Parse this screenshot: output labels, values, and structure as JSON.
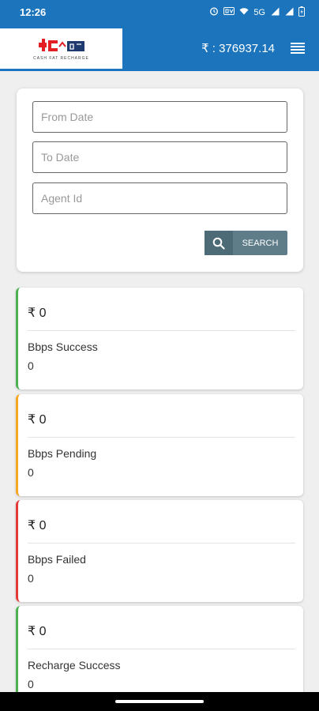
{
  "status_bar": {
    "time": "12:26",
    "icons": [
      "alarm-icon",
      "volte-icon",
      "wifi-icon",
      "5g-icon",
      "signal-icon",
      "signal-icon-2",
      "battery-icon"
    ],
    "network_5g": "5G"
  },
  "app_bar": {
    "logo_tagline": "CASH FAT RECHARGE",
    "balance": "₹ : 376937.14"
  },
  "filter": {
    "from_date_placeholder": "From Date",
    "to_date_placeholder": "To Date",
    "agent_id_placeholder": "Agent Id",
    "search_label": "SEARCH"
  },
  "stats": [
    {
      "amount": "₹ 0",
      "label": "Bbps Success",
      "count": "0",
      "color": "#4caf50"
    },
    {
      "amount": "₹ 0",
      "label": "Bbps Pending",
      "count": "0",
      "color": "#f5a623"
    },
    {
      "amount": "₹ 0",
      "label": "Bbps Failed",
      "count": "0",
      "color": "#e53935"
    },
    {
      "amount": "₹ 0",
      "label": "Recharge Success",
      "count": "0",
      "color": "#4caf50"
    }
  ],
  "colors": {
    "primary": "#1c75bc",
    "search_button": "#5f7d89"
  }
}
